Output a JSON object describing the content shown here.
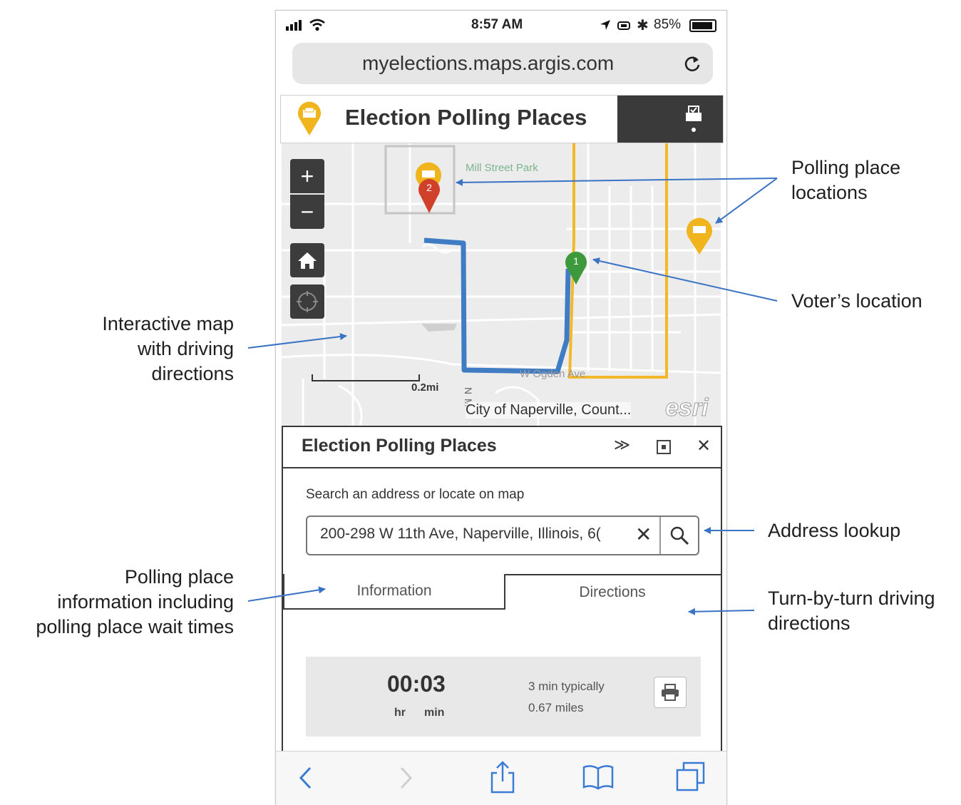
{
  "status_bar": {
    "time": "8:57 AM",
    "battery": "85%"
  },
  "browser": {
    "url": "myelections.maps.argis.com"
  },
  "app": {
    "title": "Election Polling Places"
  },
  "map": {
    "park_label": "Mill Street Park",
    "street_label": "W Ogden Ave",
    "vertical_street_label": "N M",
    "scale_label": "0.2mi",
    "attribution": "City of Naperville, Count...",
    "esri_logo": "esri",
    "markers": {
      "polling_2": "2",
      "voter_1": "1"
    }
  },
  "panel": {
    "title": "Election Polling Places",
    "search_label": "Search an address or locate on map",
    "search_value": "200-298 W 11th Ave, Naperville, Illinois, 6(",
    "tabs": [
      "Information",
      "Directions"
    ],
    "summary": {
      "time": "00:03",
      "hr_label": "hr",
      "min_label": "min",
      "typical": "3 min typically",
      "distance": "0.67 miles"
    }
  },
  "callouts": {
    "polling_locations": [
      "Polling place",
      "locations"
    ],
    "voter_location": "Voter’s location",
    "interactive_map": [
      "Interactive map",
      "with driving",
      "directions"
    ],
    "address_lookup": "Address lookup",
    "polling_info": [
      "Polling place",
      "information including",
      "polling place wait times"
    ],
    "turn_by_turn": [
      "Turn-by-turn driving",
      "directions"
    ]
  },
  "colors": {
    "route": "#3f7cc4",
    "highlight_road": "#f3b829",
    "polling_marker": "#f0b51d",
    "destination_marker": "#d1402a",
    "voter_marker": "#3c9a3c",
    "arrow": "#3b73c4"
  }
}
